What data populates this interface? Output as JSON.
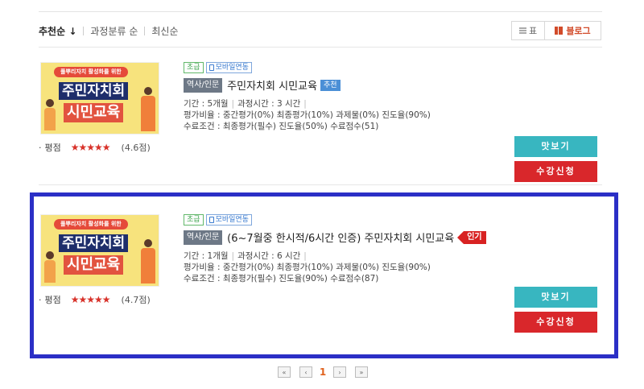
{
  "sort": {
    "options": [
      {
        "label": "추천순",
        "arrow": "↓",
        "active": true
      },
      {
        "label": "과정분류 순",
        "active": false
      },
      {
        "label": "최신순",
        "active": false
      }
    ]
  },
  "view_toggle": {
    "table_label": "표",
    "blog_label": "블로그"
  },
  "courses": [
    {
      "thumb": {
        "subtitle": "풀뿌리자치 활성화를 위한",
        "line1": "주민자치회",
        "line2": "시민교육"
      },
      "level_badge": "초급",
      "mobile_badge": "모바일연동",
      "category": "역사/인문",
      "title": "주민자치회 시민교육",
      "tag": "추천",
      "period": "기간 : 5개월",
      "hours": "과정시간 : 3 시간",
      "ratio": "평가비율 : 중간평가(0%) 최종평가(10%) 과제물(0%) 진도율(90%)",
      "conditions": "수료조건 : 최종평가(필수) 진도율(50%) 수료점수(51)",
      "rating_label": "평점",
      "stars": "★★★★★",
      "rating_value": "(4.6점)",
      "preview_label": "맛보기",
      "enroll_label": "수강신청"
    },
    {
      "thumb": {
        "subtitle": "풀뿌리자치 활성화를 위한",
        "line1": "주민자치회",
        "line2": "시민교육"
      },
      "level_badge": "초급",
      "mobile_badge": "모바일연동",
      "category": "역사/인문",
      "title": "(6~7월중 한시적/6시간 인증) 주민자치회 시민교육",
      "tag": "인기",
      "period": "기간 : 1개월",
      "hours": "과정시간 : 6 시간",
      "ratio": "평가비율 : 중간평가(0%) 최종평가(10%) 과제물(0%) 진도율(90%)",
      "conditions": "수료조건 : 최종평가(필수) 진도율(90%) 수료점수(87)",
      "rating_label": "평점",
      "stars": "★★★★★",
      "rating_value": "(4.7점)",
      "preview_label": "맛보기",
      "enroll_label": "수강신청"
    }
  ],
  "pagination": {
    "current_page": "1",
    "first": "«",
    "prev": "‹",
    "next": "›",
    "last": "»"
  },
  "colors": {
    "highlight_border": "#2b2fc6",
    "preview_button": "#38b6c0",
    "enroll_button": "#d9272b",
    "popular_tag": "#d82222",
    "recommend_tag": "#4b8fd6"
  }
}
